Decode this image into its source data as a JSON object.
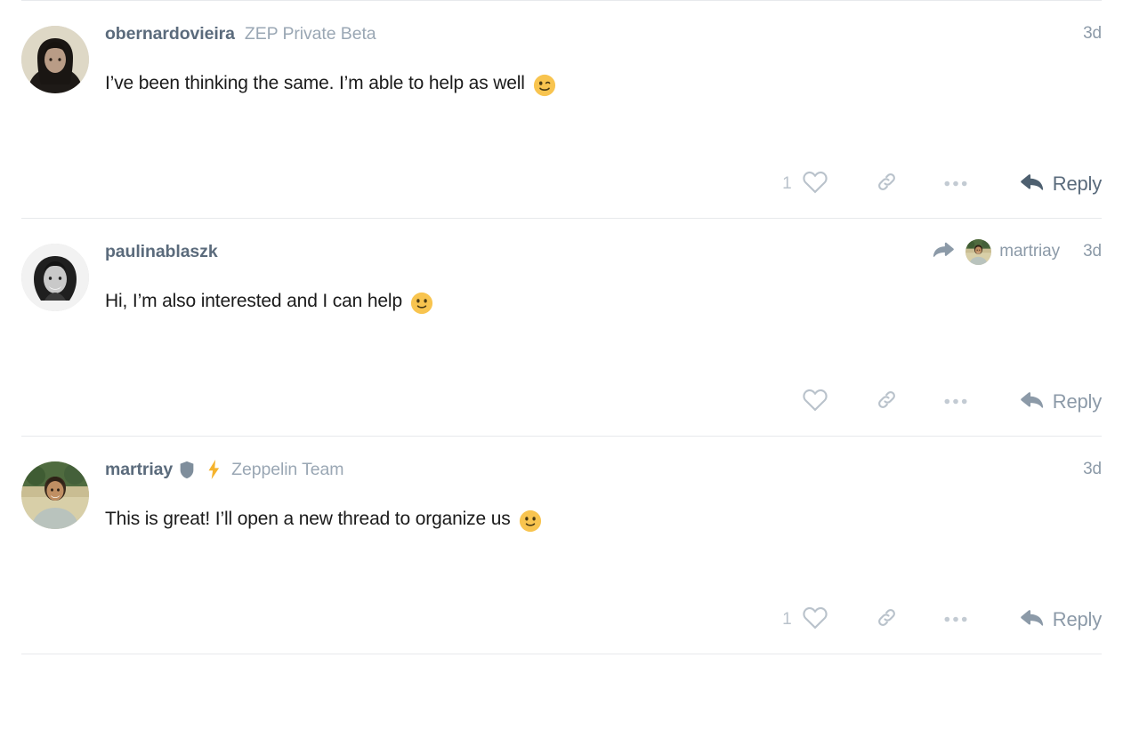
{
  "thread": {
    "posts": [
      {
        "id": "post-obernardovieira",
        "username": "obernardovieira",
        "affiliation": "ZEP Private Beta",
        "timestamp": "3d",
        "message": "I’ve been thinking the same. I’m able to help as well",
        "emoji": "winking-face",
        "like_count": "1",
        "has_like_count": true,
        "has_shield_badge": false,
        "has_bolt_badge": false,
        "reply_to": null,
        "reply_label": "Reply",
        "reply_style": "dark",
        "avatar": "portrait-long-dark-hair-cream-background"
      },
      {
        "id": "post-paulinablaszk",
        "username": "paulinablaszk",
        "affiliation": "",
        "timestamp": "3d",
        "message": "Hi, I’m also interested and I can help",
        "emoji": "slightly-smiling-face",
        "like_count": "",
        "has_like_count": false,
        "has_shield_badge": false,
        "has_bolt_badge": false,
        "reply_to": "martriay",
        "reply_label": "Reply",
        "reply_style": "light",
        "avatar": "portrait-smiling-woman-black-and-white"
      },
      {
        "id": "post-martriay",
        "username": "martriay",
        "affiliation": "Zeppelin Team",
        "timestamp": "3d",
        "message": "This is great! I’ll open a new thread to organize us",
        "emoji": "slightly-smiling-face",
        "like_count": "1",
        "has_like_count": true,
        "has_shield_badge": true,
        "has_bolt_badge": true,
        "reply_to": null,
        "reply_label": "Reply",
        "reply_style": "light",
        "avatar": "portrait-smiling-man-outdoors-color"
      }
    ]
  },
  "icons": {
    "heart": "heart-outline-icon",
    "link": "link-chain-icon",
    "more": "ellipsis-icon",
    "reply_arrow": "reply-arrow-icon",
    "forward_arrow": "forward-arrow-icon",
    "shield": "shield-icon",
    "bolt": "lightning-bolt-icon"
  },
  "colors": {
    "username": "#5b6b7c",
    "affiliation": "#9aa7b4",
    "timestamp": "#8c9aa8",
    "message": "#1b1b1b",
    "icon_muted": "#b9c2cb",
    "reply_dark": "#5a6b7c",
    "reply_light": "#8c9aa8",
    "divider": "#e7e9ec",
    "bolt": "#f5b32d",
    "shield": "#7f8e9c",
    "emoji_yellow": "#f8c44f"
  }
}
